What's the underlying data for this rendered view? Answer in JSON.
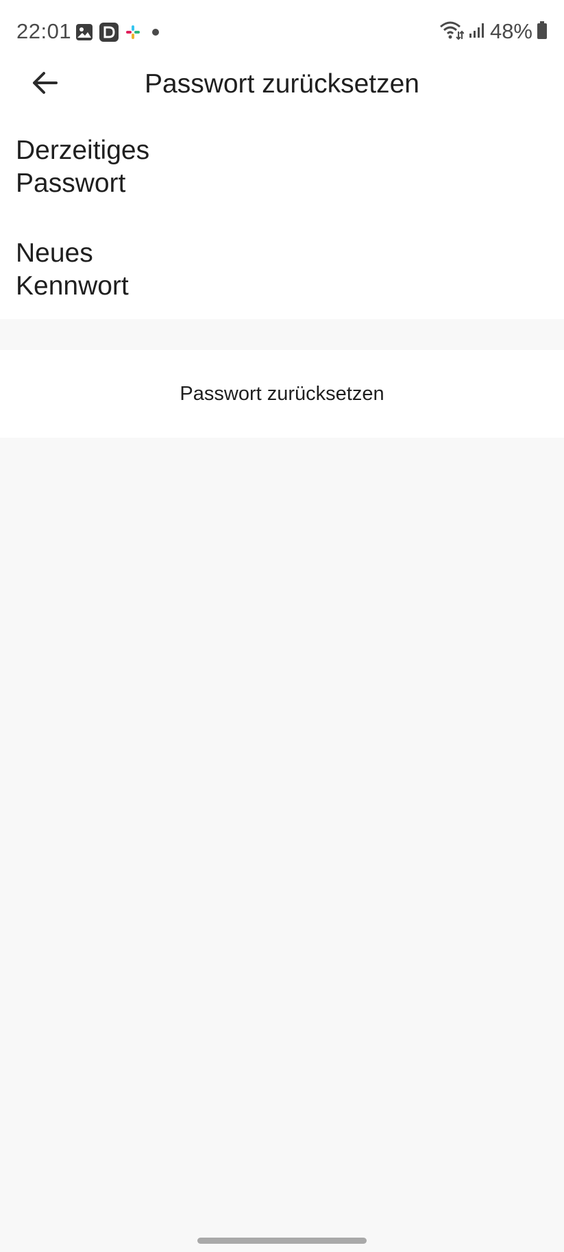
{
  "status_bar": {
    "time": "22:01",
    "notification_icons": [
      "gallery-icon",
      "app-d-icon",
      "slack-icon",
      "dot-icon"
    ],
    "battery_percent": "48%"
  },
  "app_bar": {
    "back_icon": "arrow-left-icon",
    "title": "Passwort zurücksetzen"
  },
  "form": {
    "current_password": {
      "label": "Derzeitiges Passwort",
      "value": "",
      "placeholder": ""
    },
    "new_password": {
      "label": "Neues Kennwort",
      "value": "",
      "placeholder": ""
    }
  },
  "actions": {
    "reset_label": "Passwort zurücksetzen"
  },
  "colors": {
    "background": "#f8f8f8",
    "surface": "#ffffff",
    "text": "#1f1f1f",
    "status_text": "#4a4a4a"
  }
}
